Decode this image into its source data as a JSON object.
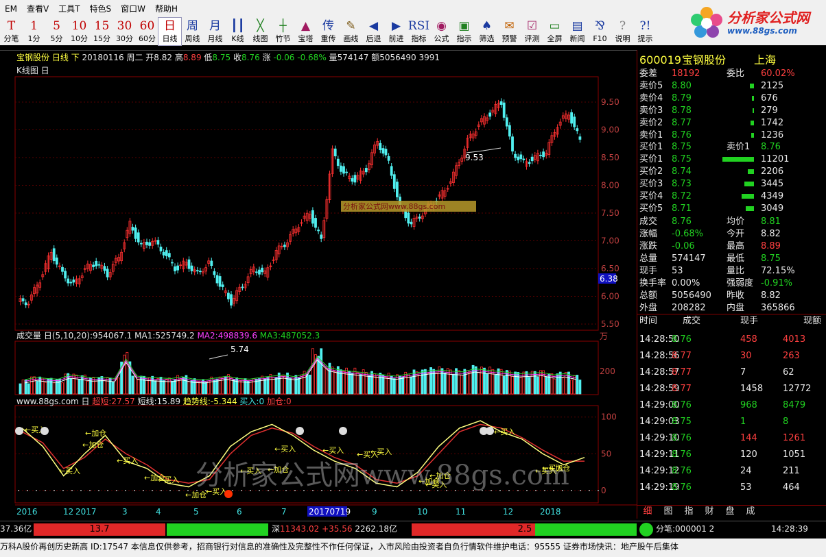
{
  "menu": [
    "EM",
    "查看V",
    "工具T",
    "特色S",
    "窗口W",
    "帮助H"
  ],
  "toolbar": [
    {
      "glyph": "T",
      "label": "分笔",
      "color": "#c00000"
    },
    {
      "glyph": "1",
      "label": "1分",
      "color": "#c00000"
    },
    {
      "glyph": "5",
      "label": "5分",
      "color": "#c00000"
    },
    {
      "glyph": "10",
      "label": "10分",
      "color": "#c00000"
    },
    {
      "glyph": "15",
      "label": "15分",
      "color": "#c00000"
    },
    {
      "glyph": "30",
      "label": "30分",
      "color": "#c00000"
    },
    {
      "glyph": "60",
      "label": "60分",
      "color": "#c00000"
    },
    {
      "glyph": "日",
      "label": "日线",
      "color": "#c00000"
    },
    {
      "glyph": "周",
      "label": "周线",
      "color": "#1a3aa0"
    },
    {
      "glyph": "月",
      "label": "月线",
      "color": "#1a3aa0"
    },
    {
      "glyph": "┃┃",
      "label": "K线",
      "color": "#1a3aa0"
    },
    {
      "glyph": "╳",
      "label": "线图",
      "color": "#208020"
    },
    {
      "glyph": "┼",
      "label": "竹节",
      "color": "#208020"
    },
    {
      "glyph": "▲",
      "label": "宝塔",
      "color": "#a01a60"
    },
    {
      "glyph": "传",
      "label": "重传",
      "color": "#1a3aa0"
    },
    {
      "glyph": "✎",
      "label": "画线",
      "color": "#806020"
    },
    {
      "glyph": "◀",
      "label": "后退",
      "color": "#1a3aa0"
    },
    {
      "glyph": "▶",
      "label": "前进",
      "color": "#1a3aa0"
    },
    {
      "glyph": "RSI",
      "label": "指标",
      "color": "#1a3aa0"
    },
    {
      "glyph": "◉",
      "label": "公式",
      "color": "#a01a60"
    },
    {
      "glyph": "▣",
      "label": "指示",
      "color": "#208020"
    },
    {
      "glyph": "♠",
      "label": "筛选",
      "color": "#1a3aa0"
    },
    {
      "glyph": "✉",
      "label": "预警",
      "color": "#c06000"
    },
    {
      "glyph": "☑",
      "label": "评测",
      "color": "#a01a60"
    },
    {
      "glyph": "▭",
      "label": "全屏",
      "color": "#208020"
    },
    {
      "glyph": "▤",
      "label": "新闻",
      "color": "#1a3aa0"
    },
    {
      "glyph": "⅋",
      "label": "F10",
      "color": "#1a3aa0"
    },
    {
      "glyph": "?",
      "label": "说明",
      "color": "#808080"
    },
    {
      "glyph": "?!",
      "label": "提示",
      "color": "#1a3aa0"
    }
  ],
  "logo": {
    "title": "分析家公式网",
    "url": "www.88gs.com"
  },
  "header": {
    "stock": "宝钢股份",
    "period": "日线",
    "adj": "下",
    "date": "20180116",
    "weekday": "周二",
    "open_l": "开",
    "open": "8.82",
    "high_l": "高",
    "high": "8.89",
    "low_l": "低",
    "low": "8.75",
    "close_l": "收",
    "close": "8.76",
    "chg_l": "涨",
    "chg": "-0.06",
    "chgpct": "-0.68%",
    "vol_l": "量",
    "vol": "574147",
    "amt_l": "额",
    "amt": "5056490",
    "extra": "3991"
  },
  "kline_title": "K线图 日",
  "price_axis": [
    "9.50",
    "9.00",
    "8.50",
    "8.00",
    "7.50",
    "7.00",
    "6.50",
    "6.00",
    "5.50"
  ],
  "current_price_tag": "6.38",
  "annotations": {
    "high": "9.53",
    "low": "5.74",
    "watermark": "分析家公式网www.88gs.com"
  },
  "volume": {
    "title": "成交量 日(5,10,20)",
    "value": ":954067.1",
    "ma1": "MA1:525749.2",
    "ma2": "MA2:498839.6",
    "ma3": "MA3:487052.3",
    "unit": "万",
    "tick": "200"
  },
  "indicator": {
    "title": "www.88gs.com 日",
    "超短": "超短:27.57",
    "短线": "短线:15.89",
    "趋势线": "趋势线:-5.344",
    "买入": "买入:0",
    "加仓": "加仓:0",
    "ticks": [
      "100",
      "50",
      "0"
    ],
    "big_watermark": "分析家公式网www.88gs.com"
  },
  "signals": [
    "买入",
    "加仓",
    "买入",
    "加仓",
    "买入",
    "加仓",
    "买入",
    "加仓",
    "买入",
    "买入",
    "加仓",
    "买入",
    "买入",
    "买入",
    "买入",
    "买入",
    "加仓",
    "加仓",
    "买入",
    "买入",
    "买入",
    "加仓"
  ],
  "time_axis": [
    "2016",
    "12",
    "2017",
    "3",
    "4",
    "5",
    "6",
    "7",
    "20170719",
    "9",
    "10",
    "11",
    "12",
    "2018"
  ],
  "chart_data": [
    {
      "type": "line",
      "title": "K线图",
      "approx": true,
      "series": [
        {
          "name": "收盘",
          "values": [
            5.9,
            6.3,
            6.8,
            6.4,
            6.2,
            6.5,
            6.6,
            6.4,
            6.7,
            7.3,
            6.9,
            7.0,
            6.8,
            6.5,
            6.6,
            6.4,
            6.6,
            6.2,
            5.9,
            6.2,
            6.5,
            6.4,
            6.8,
            7.0,
            7.3,
            7.5,
            7.0,
            8.6,
            8.2,
            8.1,
            8.3,
            8.8,
            8.4,
            7.6,
            7.3,
            7.5,
            7.7,
            7.9,
            8.3,
            8.8,
            9.1,
            9.3,
            9.5,
            8.6,
            8.4,
            8.5,
            8.6,
            9.1,
            9.3,
            8.8
          ]
        }
      ],
      "ylim": [
        5.5,
        9.6
      ]
    },
    {
      "type": "bar",
      "title": "成交量",
      "approx": true,
      "values": [
        90,
        110,
        100,
        95,
        130,
        120,
        105,
        110,
        100,
        260,
        120,
        110,
        105,
        100,
        115,
        95,
        90,
        105,
        120,
        100,
        95,
        110,
        120,
        130,
        115,
        140,
        280,
        190,
        170,
        160,
        150,
        140,
        130,
        120,
        135,
        150,
        165,
        170,
        160,
        155,
        180,
        170,
        160,
        150,
        140,
        145,
        150,
        130,
        140,
        120
      ]
    },
    {
      "type": "line",
      "title": "指标",
      "approx": true,
      "series": [
        {
          "name": "超短",
          "values": [
            85,
            60,
            20,
            50,
            75,
            40,
            30,
            10,
            5,
            20,
            60,
            80,
            90,
            75,
            55,
            40,
            30,
            10,
            5,
            25,
            60,
            85,
            95,
            80,
            70,
            50,
            35,
            45
          ]
        },
        {
          "name": "短线",
          "values": [
            80,
            65,
            30,
            45,
            70,
            50,
            35,
            15,
            10,
            15,
            50,
            75,
            85,
            78,
            60,
            45,
            35,
            15,
            10,
            20,
            50,
            80,
            90,
            85,
            72,
            55,
            40,
            40
          ]
        }
      ],
      "ylim": [
        0,
        110
      ]
    }
  ],
  "quote": {
    "code": "600019",
    "name": "宝钢股份",
    "market": "上海",
    "weicha_l": "委差",
    "weicha": "18192",
    "weibi_l": "委比",
    "weibi": "60.02%",
    "sells": [
      {
        "l": "卖价5",
        "p": "8.80",
        "v": "2125",
        "w": 6
      },
      {
        "l": "卖价4",
        "p": "8.79",
        "v": "676",
        "w": 3
      },
      {
        "l": "卖价3",
        "p": "8.78",
        "v": "279",
        "w": 2
      },
      {
        "l": "卖价2",
        "p": "8.77",
        "v": "1742",
        "w": 5
      },
      {
        "l": "卖价1",
        "p": "8.76",
        "v": "1236",
        "w": 4
      }
    ],
    "buy1_l": "买价1",
    "buy1": "8.75",
    "sell1_l": "卖价1",
    "sell1": "8.76",
    "buys": [
      {
        "l": "买价1",
        "p": "8.75",
        "v": "11201",
        "w": 46
      },
      {
        "l": "买价2",
        "p": "8.74",
        "v": "2206",
        "w": 9
      },
      {
        "l": "买价3",
        "p": "8.73",
        "v": "3445",
        "w": 14
      },
      {
        "l": "买价4",
        "p": "8.72",
        "v": "4349",
        "w": 18
      },
      {
        "l": "买价5",
        "p": "8.71",
        "v": "3049",
        "w": 12
      }
    ],
    "stats": [
      [
        "成交",
        "8.76",
        "均价",
        "8.81"
      ],
      [
        "涨幅",
        "-0.68%",
        "今开",
        "8.82"
      ],
      [
        "涨跌",
        "-0.06",
        "最高",
        "8.89"
      ],
      [
        "总量",
        "574147",
        "最低",
        "8.75"
      ],
      [
        "现手",
        "53",
        "量比",
        "72.15%"
      ],
      [
        "换手率",
        "0.00%",
        "强弱度",
        "-0.91%"
      ],
      [
        "总额",
        "5056490",
        "昨收",
        "8.82"
      ],
      [
        "外盘",
        "208282",
        "内盘",
        "365866"
      ]
    ],
    "tick_headers": [
      "时间",
      "成交",
      "现手",
      "现额"
    ],
    "ticks": [
      [
        "14:28:50",
        "8.76",
        "458",
        "4013"
      ],
      [
        "14:28:56",
        "8.77",
        "30",
        "263"
      ],
      [
        "14:28:57",
        "8.77",
        "7",
        "62"
      ],
      [
        "14:28:59",
        "8.77",
        "1458",
        "12772"
      ],
      [
        "14:29:00",
        "8.76",
        "968",
        "8479"
      ],
      [
        "14:29:03",
        "8.75",
        "1",
        "8"
      ],
      [
        "14:29:10",
        "8.76",
        "144",
        "1261"
      ],
      [
        "14:29:11",
        "8.76",
        "120",
        "1051"
      ],
      [
        "14:29:12",
        "8.76",
        "24",
        "211"
      ],
      [
        "14:29:19",
        "8.76",
        "53",
        "464"
      ]
    ],
    "tabs": [
      "细",
      "图",
      "指",
      "财",
      "盘",
      "成"
    ]
  },
  "status": {
    "left_amt": "37.36亿",
    "bar1": "13.7",
    "sz_label": "深",
    "sz_index": "11343.02",
    "sz_chg": "+35.56",
    "sz_amt": "2262.18亿",
    "bar2": "2.5",
    "fenbi": "分笔:000001 2",
    "time": "14:28:39"
  },
  "ticker": "万科A股价再创历史新高 ID:17547    本信息仅供参考，招商银行对信息的准确性及完整性不作任何保证，入市风险由投资者自负行情软件维护电话：95555    证券市场快讯：地产股午后集体"
}
